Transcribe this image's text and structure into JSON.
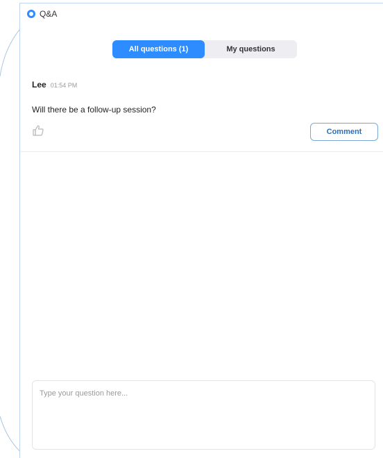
{
  "window": {
    "title": "Q&A",
    "icon": "zoom-logo-icon"
  },
  "tabs": [
    {
      "label": "All questions (1)",
      "active": true
    },
    {
      "label": "My questions",
      "active": false
    }
  ],
  "questions": [
    {
      "author": "Lee",
      "time": "01:54 PM",
      "text": "Will there be a follow-up session?",
      "like_icon": "thumbs-up-icon",
      "comment_label": "Comment"
    }
  ],
  "question_input": {
    "value": "",
    "placeholder": "Type your question here..."
  },
  "colors": {
    "accent": "#2d8cff",
    "tab_bg": "#eeeef2",
    "comment_border": "#7aa7d9"
  }
}
